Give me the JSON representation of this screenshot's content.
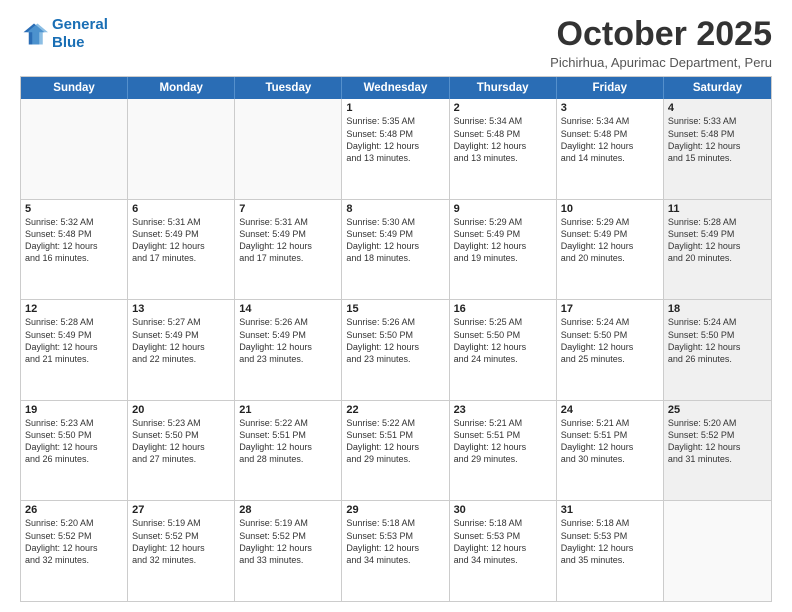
{
  "logo": {
    "line1": "General",
    "line2": "Blue"
  },
  "title": "October 2025",
  "subtitle": "Pichirhua, Apurimac Department, Peru",
  "days": [
    "Sunday",
    "Monday",
    "Tuesday",
    "Wednesday",
    "Thursday",
    "Friday",
    "Saturday"
  ],
  "rows": [
    [
      {
        "day": "",
        "text": "",
        "empty": true
      },
      {
        "day": "",
        "text": "",
        "empty": true
      },
      {
        "day": "",
        "text": "",
        "empty": true
      },
      {
        "day": "1",
        "text": "Sunrise: 5:35 AM\nSunset: 5:48 PM\nDaylight: 12 hours\nand 13 minutes."
      },
      {
        "day": "2",
        "text": "Sunrise: 5:34 AM\nSunset: 5:48 PM\nDaylight: 12 hours\nand 13 minutes."
      },
      {
        "day": "3",
        "text": "Sunrise: 5:34 AM\nSunset: 5:48 PM\nDaylight: 12 hours\nand 14 minutes."
      },
      {
        "day": "4",
        "text": "Sunrise: 5:33 AM\nSunset: 5:48 PM\nDaylight: 12 hours\nand 15 minutes.",
        "shaded": true
      }
    ],
    [
      {
        "day": "5",
        "text": "Sunrise: 5:32 AM\nSunset: 5:48 PM\nDaylight: 12 hours\nand 16 minutes."
      },
      {
        "day": "6",
        "text": "Sunrise: 5:31 AM\nSunset: 5:49 PM\nDaylight: 12 hours\nand 17 minutes."
      },
      {
        "day": "7",
        "text": "Sunrise: 5:31 AM\nSunset: 5:49 PM\nDaylight: 12 hours\nand 17 minutes."
      },
      {
        "day": "8",
        "text": "Sunrise: 5:30 AM\nSunset: 5:49 PM\nDaylight: 12 hours\nand 18 minutes."
      },
      {
        "day": "9",
        "text": "Sunrise: 5:29 AM\nSunset: 5:49 PM\nDaylight: 12 hours\nand 19 minutes."
      },
      {
        "day": "10",
        "text": "Sunrise: 5:29 AM\nSunset: 5:49 PM\nDaylight: 12 hours\nand 20 minutes."
      },
      {
        "day": "11",
        "text": "Sunrise: 5:28 AM\nSunset: 5:49 PM\nDaylight: 12 hours\nand 20 minutes.",
        "shaded": true
      }
    ],
    [
      {
        "day": "12",
        "text": "Sunrise: 5:28 AM\nSunset: 5:49 PM\nDaylight: 12 hours\nand 21 minutes."
      },
      {
        "day": "13",
        "text": "Sunrise: 5:27 AM\nSunset: 5:49 PM\nDaylight: 12 hours\nand 22 minutes."
      },
      {
        "day": "14",
        "text": "Sunrise: 5:26 AM\nSunset: 5:49 PM\nDaylight: 12 hours\nand 23 minutes."
      },
      {
        "day": "15",
        "text": "Sunrise: 5:26 AM\nSunset: 5:50 PM\nDaylight: 12 hours\nand 23 minutes."
      },
      {
        "day": "16",
        "text": "Sunrise: 5:25 AM\nSunset: 5:50 PM\nDaylight: 12 hours\nand 24 minutes."
      },
      {
        "day": "17",
        "text": "Sunrise: 5:24 AM\nSunset: 5:50 PM\nDaylight: 12 hours\nand 25 minutes."
      },
      {
        "day": "18",
        "text": "Sunrise: 5:24 AM\nSunset: 5:50 PM\nDaylight: 12 hours\nand 26 minutes.",
        "shaded": true
      }
    ],
    [
      {
        "day": "19",
        "text": "Sunrise: 5:23 AM\nSunset: 5:50 PM\nDaylight: 12 hours\nand 26 minutes."
      },
      {
        "day": "20",
        "text": "Sunrise: 5:23 AM\nSunset: 5:50 PM\nDaylight: 12 hours\nand 27 minutes."
      },
      {
        "day": "21",
        "text": "Sunrise: 5:22 AM\nSunset: 5:51 PM\nDaylight: 12 hours\nand 28 minutes."
      },
      {
        "day": "22",
        "text": "Sunrise: 5:22 AM\nSunset: 5:51 PM\nDaylight: 12 hours\nand 29 minutes."
      },
      {
        "day": "23",
        "text": "Sunrise: 5:21 AM\nSunset: 5:51 PM\nDaylight: 12 hours\nand 29 minutes."
      },
      {
        "day": "24",
        "text": "Sunrise: 5:21 AM\nSunset: 5:51 PM\nDaylight: 12 hours\nand 30 minutes."
      },
      {
        "day": "25",
        "text": "Sunrise: 5:20 AM\nSunset: 5:52 PM\nDaylight: 12 hours\nand 31 minutes.",
        "shaded": true
      }
    ],
    [
      {
        "day": "26",
        "text": "Sunrise: 5:20 AM\nSunset: 5:52 PM\nDaylight: 12 hours\nand 32 minutes."
      },
      {
        "day": "27",
        "text": "Sunrise: 5:19 AM\nSunset: 5:52 PM\nDaylight: 12 hours\nand 32 minutes."
      },
      {
        "day": "28",
        "text": "Sunrise: 5:19 AM\nSunset: 5:52 PM\nDaylight: 12 hours\nand 33 minutes."
      },
      {
        "day": "29",
        "text": "Sunrise: 5:18 AM\nSunset: 5:53 PM\nDaylight: 12 hours\nand 34 minutes."
      },
      {
        "day": "30",
        "text": "Sunrise: 5:18 AM\nSunset: 5:53 PM\nDaylight: 12 hours\nand 34 minutes."
      },
      {
        "day": "31",
        "text": "Sunrise: 5:18 AM\nSunset: 5:53 PM\nDaylight: 12 hours\nand 35 minutes."
      },
      {
        "day": "",
        "text": "",
        "empty": true
      }
    ]
  ]
}
